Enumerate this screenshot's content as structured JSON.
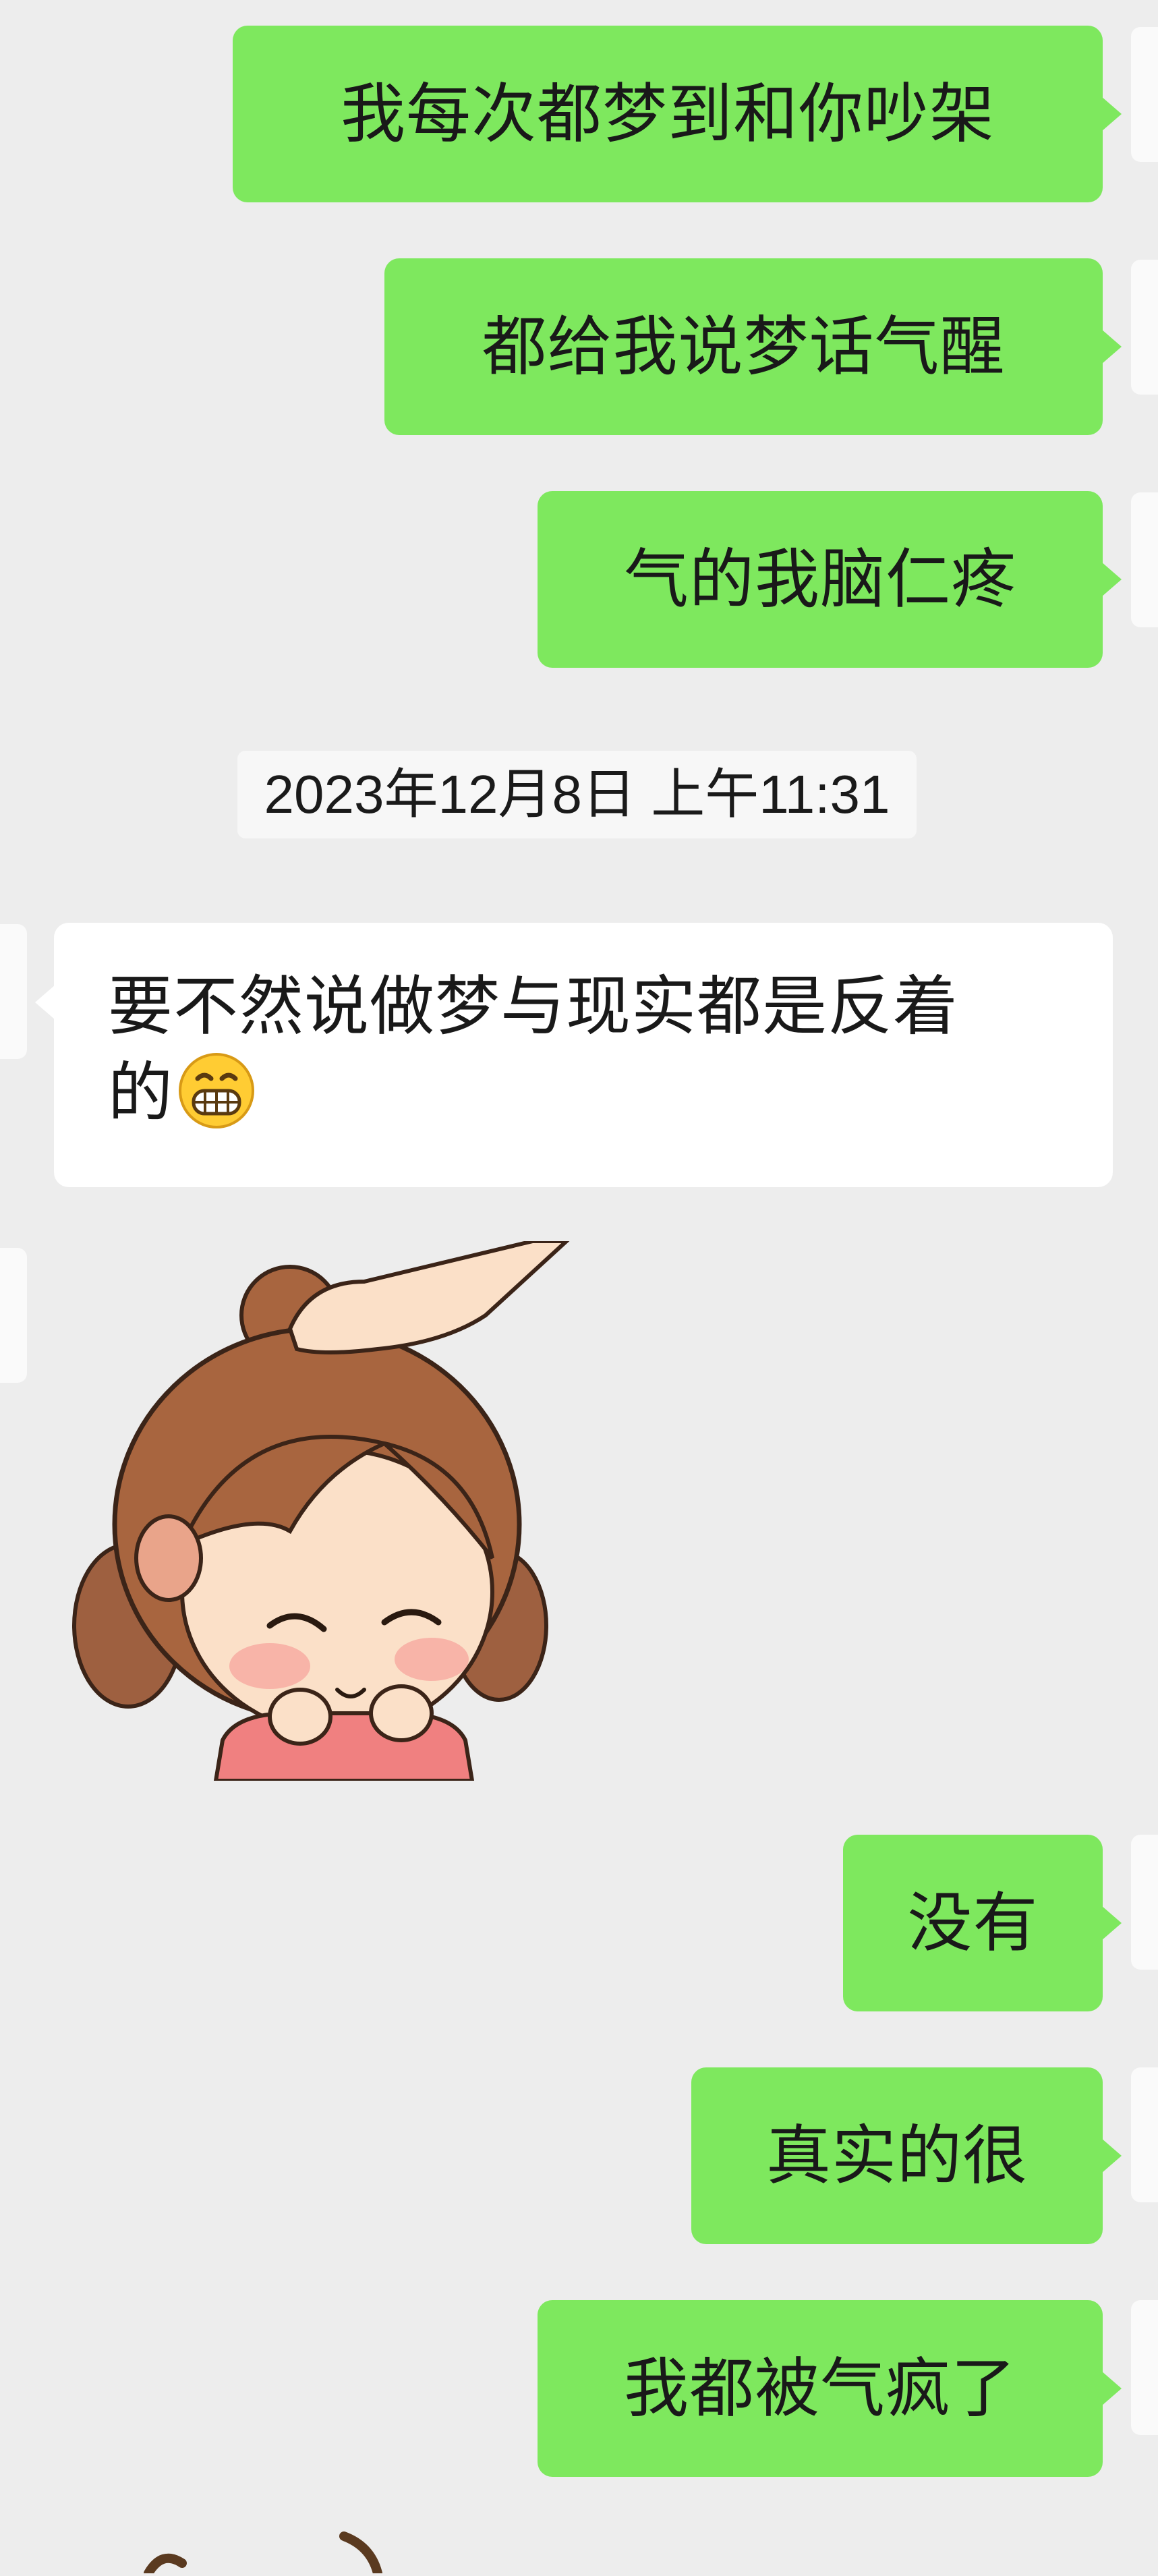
{
  "messages_top": [
    {
      "side": "sent",
      "text": "我每次都梦到和你吵架"
    },
    {
      "side": "sent",
      "text": "都给我说梦话气醒"
    },
    {
      "side": "sent",
      "text": "气的我脑仁疼"
    }
  ],
  "timestamp": "2023年12月8日 上午11:31",
  "received_message": {
    "line1": "要不然说做梦与现实都是反着",
    "line2": "的",
    "emoji": "grinning-face-emoji"
  },
  "sticker": {
    "icon": "cartoon-girl-head-pat-sticker"
  },
  "messages_bottom": [
    {
      "side": "sent",
      "text": "没有"
    },
    {
      "side": "sent",
      "text": "真实的很"
    },
    {
      "side": "sent",
      "text": "我都被气疯了"
    }
  ],
  "colors": {
    "background": "#ededed",
    "sent_bubble": "#7ee85e",
    "received_bubble": "#ffffff",
    "timestamp_bg": "#f7f7f7"
  }
}
